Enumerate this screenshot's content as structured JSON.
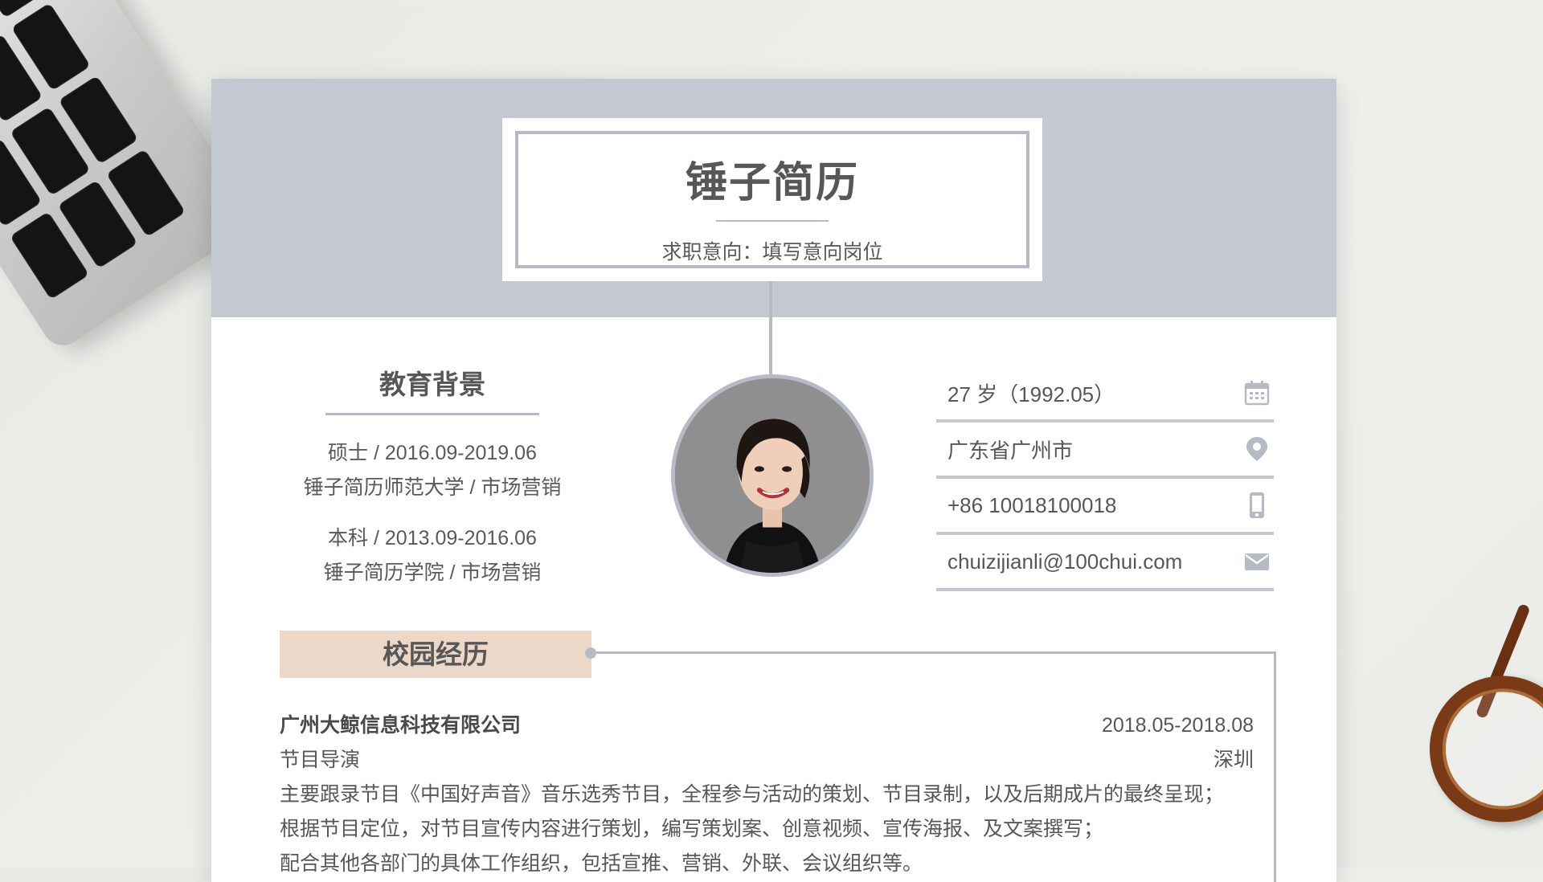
{
  "resume": {
    "title": "锤子简历",
    "subtitle": "求职意向：填写意向岗位"
  },
  "education": {
    "heading": "教育背景",
    "entries": [
      {
        "line1": "硕士  / 2016.09-2019.06",
        "line2": "锤子简历师范大学  /  市场营销"
      },
      {
        "line1": "本科  / 2013.09-2016.06",
        "line2": "锤子简历学院  /  市场营销"
      }
    ]
  },
  "contact": {
    "age": "27 岁（1992.05）",
    "location": "广东省广州市",
    "phone": "+86 10018100018",
    "email": "chuizijianli@100chui.com",
    "icons": [
      "calendar-icon",
      "location-pin-icon",
      "phone-icon",
      "mail-icon"
    ]
  },
  "campus": {
    "heading": "校园经历",
    "company": "广州大鲸信息科技有限公司",
    "period": "2018.05-2018.08",
    "role": "节目导演",
    "city": "深圳",
    "desc": [
      "主要跟录节目《中国好声音》音乐选秀节目，全程参与活动的策划、节目录制，以及后期成片的最终呈现；",
      "根据节目定位，对节目宣传内容进行策划，编写策划案、创意视频、宣传海报、及文案撰写；",
      "配合其他各部门的具体工作组织，包括宣推、营销、外联、会议组织等。"
    ]
  },
  "colors": {
    "banner": "#c4c8d0",
    "accent_line": "#b5bac4",
    "section_bar": "#ecd8c9",
    "text": "#575757"
  }
}
